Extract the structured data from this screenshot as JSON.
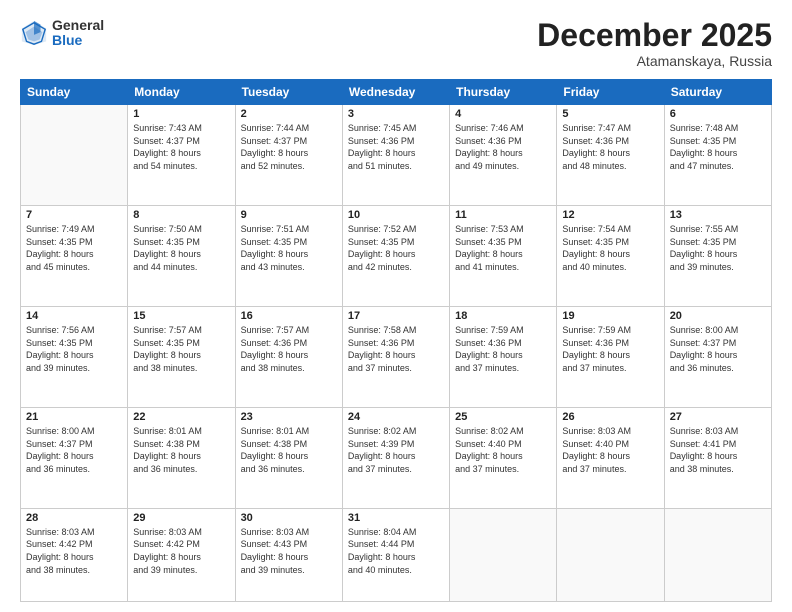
{
  "logo": {
    "general": "General",
    "blue": "Blue"
  },
  "header": {
    "month": "December 2025",
    "location": "Atamanskaya, Russia"
  },
  "weekdays": [
    "Sunday",
    "Monday",
    "Tuesday",
    "Wednesday",
    "Thursday",
    "Friday",
    "Saturday"
  ],
  "weeks": [
    [
      {
        "day": "",
        "info": ""
      },
      {
        "day": "1",
        "info": "Sunrise: 7:43 AM\nSunset: 4:37 PM\nDaylight: 8 hours\nand 54 minutes."
      },
      {
        "day": "2",
        "info": "Sunrise: 7:44 AM\nSunset: 4:37 PM\nDaylight: 8 hours\nand 52 minutes."
      },
      {
        "day": "3",
        "info": "Sunrise: 7:45 AM\nSunset: 4:36 PM\nDaylight: 8 hours\nand 51 minutes."
      },
      {
        "day": "4",
        "info": "Sunrise: 7:46 AM\nSunset: 4:36 PM\nDaylight: 8 hours\nand 49 minutes."
      },
      {
        "day": "5",
        "info": "Sunrise: 7:47 AM\nSunset: 4:36 PM\nDaylight: 8 hours\nand 48 minutes."
      },
      {
        "day": "6",
        "info": "Sunrise: 7:48 AM\nSunset: 4:35 PM\nDaylight: 8 hours\nand 47 minutes."
      }
    ],
    [
      {
        "day": "7",
        "info": "Sunrise: 7:49 AM\nSunset: 4:35 PM\nDaylight: 8 hours\nand 45 minutes."
      },
      {
        "day": "8",
        "info": "Sunrise: 7:50 AM\nSunset: 4:35 PM\nDaylight: 8 hours\nand 44 minutes."
      },
      {
        "day": "9",
        "info": "Sunrise: 7:51 AM\nSunset: 4:35 PM\nDaylight: 8 hours\nand 43 minutes."
      },
      {
        "day": "10",
        "info": "Sunrise: 7:52 AM\nSunset: 4:35 PM\nDaylight: 8 hours\nand 42 minutes."
      },
      {
        "day": "11",
        "info": "Sunrise: 7:53 AM\nSunset: 4:35 PM\nDaylight: 8 hours\nand 41 minutes."
      },
      {
        "day": "12",
        "info": "Sunrise: 7:54 AM\nSunset: 4:35 PM\nDaylight: 8 hours\nand 40 minutes."
      },
      {
        "day": "13",
        "info": "Sunrise: 7:55 AM\nSunset: 4:35 PM\nDaylight: 8 hours\nand 39 minutes."
      }
    ],
    [
      {
        "day": "14",
        "info": "Sunrise: 7:56 AM\nSunset: 4:35 PM\nDaylight: 8 hours\nand 39 minutes."
      },
      {
        "day": "15",
        "info": "Sunrise: 7:57 AM\nSunset: 4:35 PM\nDaylight: 8 hours\nand 38 minutes."
      },
      {
        "day": "16",
        "info": "Sunrise: 7:57 AM\nSunset: 4:36 PM\nDaylight: 8 hours\nand 38 minutes."
      },
      {
        "day": "17",
        "info": "Sunrise: 7:58 AM\nSunset: 4:36 PM\nDaylight: 8 hours\nand 37 minutes."
      },
      {
        "day": "18",
        "info": "Sunrise: 7:59 AM\nSunset: 4:36 PM\nDaylight: 8 hours\nand 37 minutes."
      },
      {
        "day": "19",
        "info": "Sunrise: 7:59 AM\nSunset: 4:36 PM\nDaylight: 8 hours\nand 37 minutes."
      },
      {
        "day": "20",
        "info": "Sunrise: 8:00 AM\nSunset: 4:37 PM\nDaylight: 8 hours\nand 36 minutes."
      }
    ],
    [
      {
        "day": "21",
        "info": "Sunrise: 8:00 AM\nSunset: 4:37 PM\nDaylight: 8 hours\nand 36 minutes."
      },
      {
        "day": "22",
        "info": "Sunrise: 8:01 AM\nSunset: 4:38 PM\nDaylight: 8 hours\nand 36 minutes."
      },
      {
        "day": "23",
        "info": "Sunrise: 8:01 AM\nSunset: 4:38 PM\nDaylight: 8 hours\nand 36 minutes."
      },
      {
        "day": "24",
        "info": "Sunrise: 8:02 AM\nSunset: 4:39 PM\nDaylight: 8 hours\nand 37 minutes."
      },
      {
        "day": "25",
        "info": "Sunrise: 8:02 AM\nSunset: 4:40 PM\nDaylight: 8 hours\nand 37 minutes."
      },
      {
        "day": "26",
        "info": "Sunrise: 8:03 AM\nSunset: 4:40 PM\nDaylight: 8 hours\nand 37 minutes."
      },
      {
        "day": "27",
        "info": "Sunrise: 8:03 AM\nSunset: 4:41 PM\nDaylight: 8 hours\nand 38 minutes."
      }
    ],
    [
      {
        "day": "28",
        "info": "Sunrise: 8:03 AM\nSunset: 4:42 PM\nDaylight: 8 hours\nand 38 minutes."
      },
      {
        "day": "29",
        "info": "Sunrise: 8:03 AM\nSunset: 4:42 PM\nDaylight: 8 hours\nand 39 minutes."
      },
      {
        "day": "30",
        "info": "Sunrise: 8:03 AM\nSunset: 4:43 PM\nDaylight: 8 hours\nand 39 minutes."
      },
      {
        "day": "31",
        "info": "Sunrise: 8:04 AM\nSunset: 4:44 PM\nDaylight: 8 hours\nand 40 minutes."
      },
      {
        "day": "",
        "info": ""
      },
      {
        "day": "",
        "info": ""
      },
      {
        "day": "",
        "info": ""
      }
    ]
  ]
}
